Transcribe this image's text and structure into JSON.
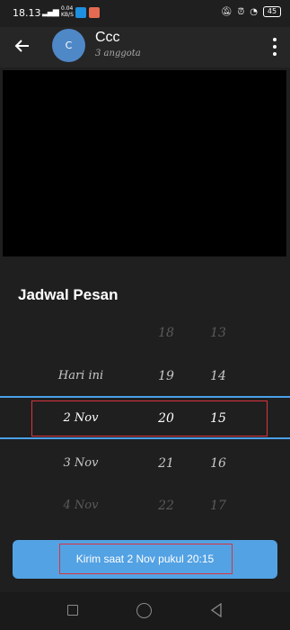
{
  "status_bar": {
    "time": "18.13",
    "signal": "4G",
    "net_speed": "0.04",
    "net_unit": "KB/S",
    "battery": "45"
  },
  "header": {
    "avatar_letter": "C",
    "title": "Ccc",
    "subtitle": "3 anggota"
  },
  "sheet": {
    "title": "Jadwal Pesan",
    "picker": {
      "rows": [
        {
          "day": "",
          "hour": "18",
          "minute": "13"
        },
        {
          "day": "Hari ini",
          "hour": "19",
          "minute": "14"
        },
        {
          "day": "2 Nov",
          "hour": "20",
          "minute": "15"
        },
        {
          "day": "3 Nov",
          "hour": "21",
          "minute": "16"
        },
        {
          "day": "4 Nov",
          "hour": "22",
          "minute": "17"
        }
      ]
    },
    "send_label": "Kirim saat 2 Nov pukul 20:15"
  },
  "colors": {
    "accent": "#53a2e4",
    "highlight_box": "#d9343d",
    "background": "#1f1f1f"
  }
}
